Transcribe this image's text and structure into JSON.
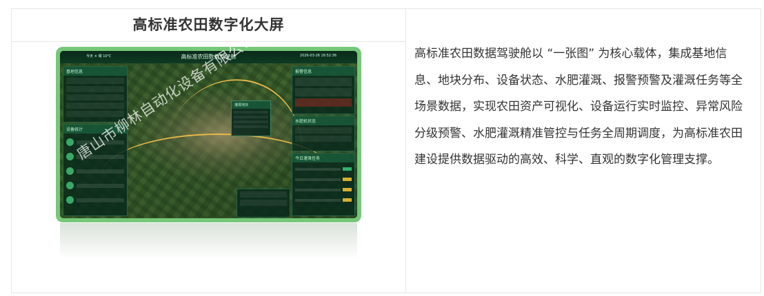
{
  "card": {
    "title": "高标准农田数字化大屏",
    "description": "高标准农田数据驾驶舱以 “一张图” 为核心载体，集成基地信息、地块分布、设备状态、水肥灌溉、报警预警及灌溉任务等全场景数据，实现农田资产可视化、设备运行实时监控、异常风险分级预警、水肥灌溉精准管控与任务全周期调度，为高标准农田建设提供数据驱动的高效、科学、直观的数字化管理支撑。"
  },
  "screen": {
    "title": "高标准农田数据驾驶舱",
    "weather": "今天 ☀ 晴 10℃",
    "datetime": "2026-03-26 16:52:36",
    "panels": {
      "base_info": "基地信息",
      "device_stats": "设备统计",
      "alarm_info": "报警信息",
      "fertigation_status": "水肥机状态",
      "today_tasks": "今日灌溉任务",
      "popup": "灌溉地块"
    }
  },
  "watermark": "唐山市柳林自动化设备有限公司",
  "colors": {
    "frame": "#76c779",
    "text": "#333333",
    "border": "#e6e6e6"
  }
}
